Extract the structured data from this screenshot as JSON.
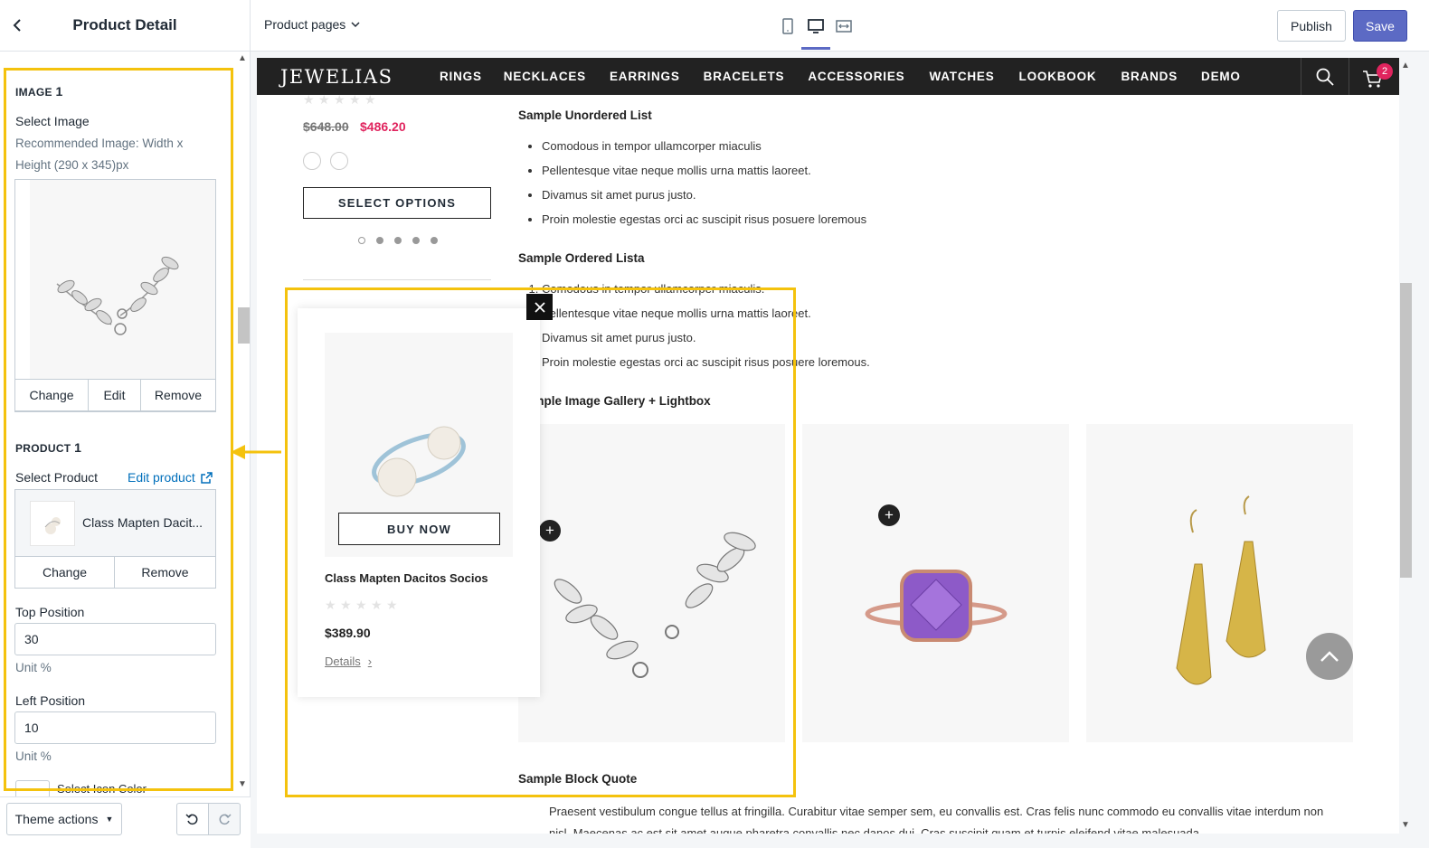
{
  "sidebar": {
    "title": "Product Detail",
    "image_section": {
      "title": "IMAGE",
      "index": "1",
      "select_label": "Select Image",
      "help": "Recommended Image: Width x Height (290 x 345)px",
      "buttons": [
        "Change",
        "Edit",
        "Remove"
      ]
    },
    "product_section": {
      "title": "PRODUCT",
      "index": "1",
      "select_label": "Select Product",
      "edit_link": "Edit product",
      "product_name": "Class Mapten Dacit...",
      "buttons": [
        "Change",
        "Remove"
      ]
    },
    "top_position": {
      "label": "Top Position",
      "value": "30",
      "unit": "Unit %"
    },
    "left_position": {
      "label": "Left Position",
      "value": "10",
      "unit": "Unit %"
    },
    "icon_color_label": "Select Icon Color",
    "theme_actions": "Theme actions"
  },
  "topbar": {
    "page_select": "Product pages",
    "publish": "Publish",
    "save": "Save",
    "views": [
      "mobile-icon",
      "desktop-icon",
      "fullwidth-icon"
    ]
  },
  "store": {
    "logo": "JEWELIAS",
    "menu": [
      "RINGS",
      "NECKLACES",
      "EARRINGS",
      "BRACELETS",
      "ACCESSORIES",
      "WATCHES",
      "LOOKBOOK",
      "BRANDS",
      "DEMO"
    ],
    "cart_count": "2",
    "product": {
      "old_price": "$648.00",
      "new_price": "$486.20",
      "select_options": "SELECT OPTIONS"
    },
    "unordered_title": "Sample Unordered List",
    "unordered_items": [
      "Comodous in tempor ullamcorper miaculis",
      "Pellentesque vitae neque mollis urna mattis laoreet.",
      "Divamus sit amet purus justo.",
      "Proin molestie egestas orci ac suscipit risus posuere loremous"
    ],
    "ordered_title": "Sample Ordered Lista",
    "ordered_items": [
      "Comodous in tempor ullamcorper miaculis.",
      "Pellentesque vitae neque mollis urna mattis laoreet.",
      "Divamus sit amet purus justo.",
      "Proin molestie egestas orci ac suscipit risus posuere loremous."
    ],
    "gallery_title": "Sample Image Gallery + Lightbox",
    "quote_title": "Sample Block Quote",
    "quote_text": "Praesent vestibulum congue tellus at fringilla. Curabitur vitae semper sem, eu convallis est. Cras felis nunc commodo eu convallis vitae interdum non nisl. Maecenas ac est sit amet augue pharetra convallis nec danos dui. Cras suscipit quam et turpis eleifend vitae malesuada."
  },
  "popup": {
    "buy_now": "BUY NOW",
    "name": "Class Mapten Dacitos Socios",
    "price": "$389.90",
    "details": "Details"
  },
  "colors": {
    "highlight": "#f4c20d",
    "accent": "#5c6ac4",
    "sale": "#e0245e",
    "link": "#006fbb"
  }
}
